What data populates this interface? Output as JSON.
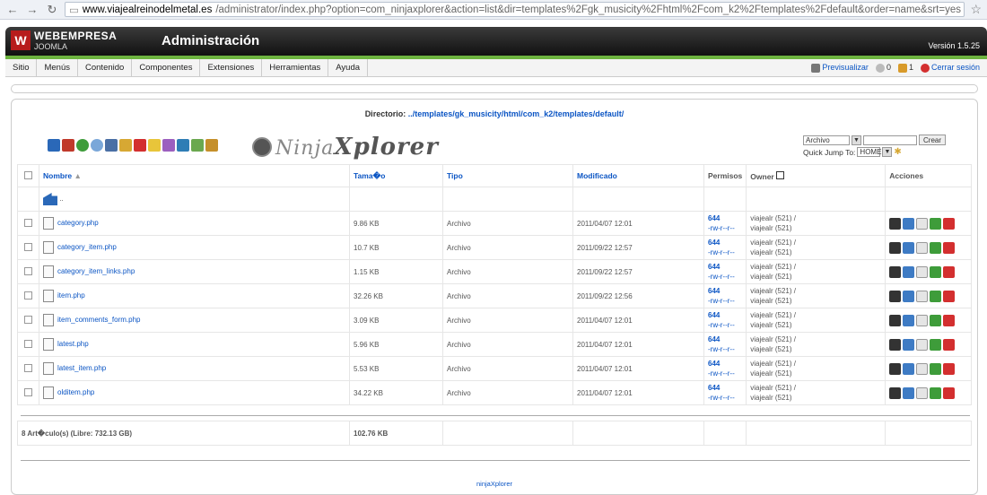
{
  "browser": {
    "url_host": "www.viajealreinodelmetal.es",
    "url_rest": "/administrator/index.php?option=com_ninjaxplorer&action=list&dir=templates%2Fgk_musicity%2Fhtml%2Fcom_k2%2Ftemplates%2Fdefault&order=name&srt=yes"
  },
  "header": {
    "logo_line1": "WEBEMPRESA",
    "logo_line2": "JOOMLA",
    "title": "Administración",
    "version": "Versión 1.5.25"
  },
  "menu": {
    "items": [
      "Sitio",
      "Menús",
      "Contenido",
      "Componentes",
      "Extensiones",
      "Herramientas",
      "Ayuda"
    ],
    "preview": "Previsualizar",
    "messages_count": "0",
    "users_count": "1",
    "logout": "Cerrar sesión"
  },
  "explorer": {
    "directory_label": "Directorio:",
    "directory_path": "../templates/gk_musicity/html/com_k2/templates/default/",
    "logo_text_a": "Ninja",
    "logo_text_b": "Xplorer",
    "select_value": "Archivo",
    "create_button": "Crear",
    "quick_jump_label": "Quick Jump To:",
    "quick_jump_value": "HOME"
  },
  "table": {
    "headers": {
      "name": "Nombre",
      "size": "Tama�o",
      "type": "Tipo",
      "modified": "Modificado",
      "perms": "Permisos",
      "owner": "Owner",
      "actions": "Acciones"
    },
    "parent": "..",
    "rows": [
      {
        "name": "category.php",
        "size": "9.86 KB",
        "type": "Archivo",
        "modified": "2011/04/07 12:01",
        "perm": "644",
        "perm_str": "-rw-r--r--",
        "owner1": "viajealr (521) /",
        "owner2": "viajealr (521)"
      },
      {
        "name": "category_item.php",
        "size": "10.7 KB",
        "type": "Archivo",
        "modified": "2011/09/22 12:57",
        "perm": "644",
        "perm_str": "-rw-r--r--",
        "owner1": "viajealr (521) /",
        "owner2": "viajealr (521)"
      },
      {
        "name": "category_item_links.php",
        "size": "1.15 KB",
        "type": "Archivo",
        "modified": "2011/09/22 12:57",
        "perm": "644",
        "perm_str": "-rw-r--r--",
        "owner1": "viajealr (521) /",
        "owner2": "viajealr (521)"
      },
      {
        "name": "item.php",
        "size": "32.26 KB",
        "type": "Archivo",
        "modified": "2011/09/22 12:56",
        "perm": "644",
        "perm_str": "-rw-r--r--",
        "owner1": "viajealr (521) /",
        "owner2": "viajealr (521)"
      },
      {
        "name": "item_comments_form.php",
        "size": "3.09 KB",
        "type": "Archivo",
        "modified": "2011/04/07 12:01",
        "perm": "644",
        "perm_str": "-rw-r--r--",
        "owner1": "viajealr (521) /",
        "owner2": "viajealr (521)"
      },
      {
        "name": "latest.php",
        "size": "5.96 KB",
        "type": "Archivo",
        "modified": "2011/04/07 12:01",
        "perm": "644",
        "perm_str": "-rw-r--r--",
        "owner1": "viajealr (521) /",
        "owner2": "viajealr (521)"
      },
      {
        "name": "latest_item.php",
        "size": "5.53 KB",
        "type": "Archivo",
        "modified": "2011/04/07 12:01",
        "perm": "644",
        "perm_str": "-rw-r--r--",
        "owner1": "viajealr (521) /",
        "owner2": "viajealr (521)"
      },
      {
        "name": "olditem.php",
        "size": "34.22 KB",
        "type": "Archivo",
        "modified": "2011/04/07 12:01",
        "perm": "644",
        "perm_str": "-rw-r--r--",
        "owner1": "viajealr (521) /",
        "owner2": "viajealr (521)"
      }
    ],
    "footer_count": "8 Art�culo(s) (Libre: 732.13 GB)",
    "footer_size": "102.76 KB"
  },
  "footer": {
    "link": "ninjaXplorer"
  },
  "colors": {
    "accent": "#0b55c4",
    "header_bg": "#1b1b1b",
    "green": "#6db33f",
    "delete": "#d32f2f"
  },
  "icons": {
    "toolbar": [
      "up-dir-icon",
      "home-icon",
      "reload-icon",
      "search-icon",
      "copy-icon",
      "move-icon",
      "delete-icon",
      "upload-icon",
      "archive-icon",
      "admin-icon",
      "logout-icon",
      "settings-icon"
    ],
    "row_actions": [
      "rename-icon",
      "edit-icon",
      "view-icon",
      "download-icon",
      "delete-icon"
    ]
  }
}
